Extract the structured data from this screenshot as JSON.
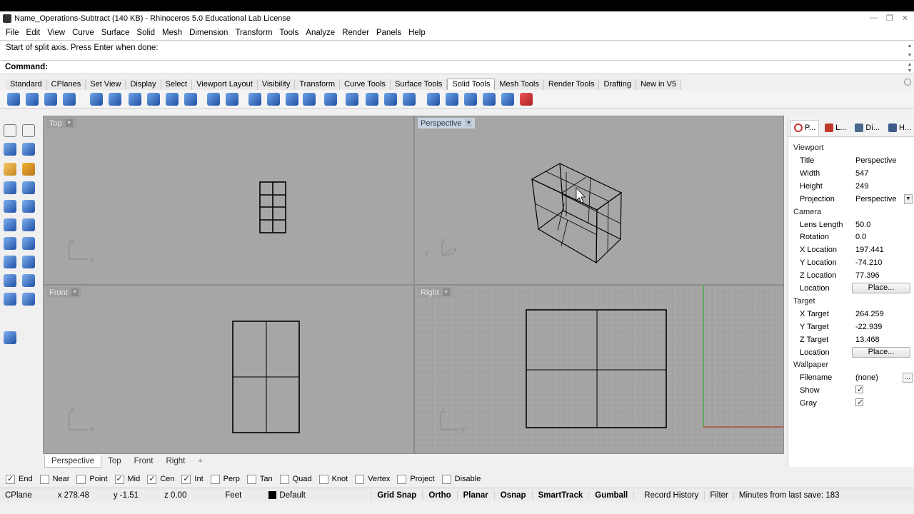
{
  "window": {
    "title": "Name_Operations-Subtract (140 KB) - Rhinoceros 5.0 Educational Lab License",
    "controls": [
      "—",
      "❐",
      "✕"
    ]
  },
  "menu": [
    "File",
    "Edit",
    "View",
    "Curve",
    "Surface",
    "Solid",
    "Mesh",
    "Dimension",
    "Transform",
    "Tools",
    "Analyze",
    "Render",
    "Panels",
    "Help"
  ],
  "command": {
    "history": "Start of split axis. Press Enter when done:",
    "prompt": "Command:"
  },
  "toolbar_tabs": {
    "items": [
      "Standard",
      "CPlanes",
      "Set View",
      "Display",
      "Select",
      "Viewport Layout",
      "Visibility",
      "Transform",
      "Curve Tools",
      "Surface Tools",
      "Solid Tools",
      "Mesh Tools",
      "Render Tools",
      "Drafting",
      "New in V5"
    ],
    "active": "Solid Tools"
  },
  "toolbar_icons": [
    "boolean-union-icon",
    "boolean-difference-icon",
    "boolean-intersection-icon",
    "boolean-split-icon",
    "extrude-face-icon",
    "fillet-edges-icon",
    "chamfer-edges-icon",
    "wirecut-icon",
    "cap-icon",
    "solid-icon",
    "extract-surface-icon",
    "solid-points-icon",
    "move-face-icon",
    "move-edge-icon",
    "split-face-icon",
    "fold-face-icon",
    "merge-face-icon",
    "rebuild-icon",
    "box-icon",
    "cylinder-icon",
    "sphere-icon",
    "cone-icon",
    "tube-icon",
    "pipe-icon",
    "mesh-icon",
    "array-icon",
    "delete-icon"
  ],
  "viewports": {
    "top": {
      "label": "Top",
      "axis_h": "x",
      "axis_v": "y"
    },
    "perspective": {
      "label": "Perspective",
      "axis_a": "y",
      "axis_b": "z",
      "axis_c": "x"
    },
    "front": {
      "label": "Front",
      "axis_h": "x",
      "axis_v": "z"
    },
    "right": {
      "label": "Right",
      "axis_h": "y",
      "axis_v": "z"
    }
  },
  "viewport_tabs": [
    "Perspective",
    "Top",
    "Front",
    "Right"
  ],
  "viewport_tab_add": "⌖",
  "osnaps": [
    {
      "label": "End",
      "checked": true
    },
    {
      "label": "Near",
      "checked": false
    },
    {
      "label": "Point",
      "checked": false
    },
    {
      "label": "Mid",
      "checked": true
    },
    {
      "label": "Cen",
      "checked": true
    },
    {
      "label": "Int",
      "checked": true
    },
    {
      "label": "Perp",
      "checked": false
    },
    {
      "label": "Tan",
      "checked": false
    },
    {
      "label": "Quad",
      "checked": false
    },
    {
      "label": "Knot",
      "checked": false
    },
    {
      "label": "Vertex",
      "checked": false
    },
    {
      "label": "Project",
      "checked": false
    },
    {
      "label": "Disable",
      "checked": false
    }
  ],
  "status": {
    "cplane": "CPlane",
    "x": "x 278.48",
    "y": "y -1.51",
    "z": "z 0.00",
    "units": "Feet",
    "layer": "Default",
    "toggles": [
      "Grid Snap",
      "Ortho",
      "Planar",
      "Osnap",
      "SmartTrack",
      "Gumball"
    ],
    "record_history": "Record History",
    "filter": "Filter",
    "last_save": "Minutes from last save: 183"
  },
  "panel": {
    "tabs": [
      "P...",
      "L...",
      "Di...",
      "H..."
    ],
    "viewport_section": "Viewport",
    "title_label": "Title",
    "title_value": "Perspective",
    "width_label": "Width",
    "width_value": "547",
    "height_label": "Height",
    "height_value": "249",
    "projection_label": "Projection",
    "projection_value": "Perspective",
    "camera_section": "Camera",
    "lens_label": "Lens Length",
    "lens_value": "50.0",
    "rotation_label": "Rotation",
    "rotation_value": "0.0",
    "xloc_label": "X Location",
    "xloc_value": "197.441",
    "yloc_label": "Y Location",
    "yloc_value": "-74.210",
    "zloc_label": "Z Location",
    "zloc_value": "77.396",
    "location_label": "Location",
    "place_button": "Place...",
    "target_section": "Target",
    "xt_label": "X Target",
    "xt_value": "264.259",
    "yt_label": "Y Target",
    "yt_value": "-22.939",
    "zt_label": "Z Target",
    "zt_value": "13.468",
    "tlocation_label": "Location",
    "tplace_button": "Place...",
    "wallpaper_section": "Wallpaper",
    "filename_label": "Filename",
    "filename_value": "(none)",
    "browse_button": "...",
    "show_label": "Show",
    "show_checked": true,
    "gray_label": "Gray",
    "gray_checked": true
  }
}
